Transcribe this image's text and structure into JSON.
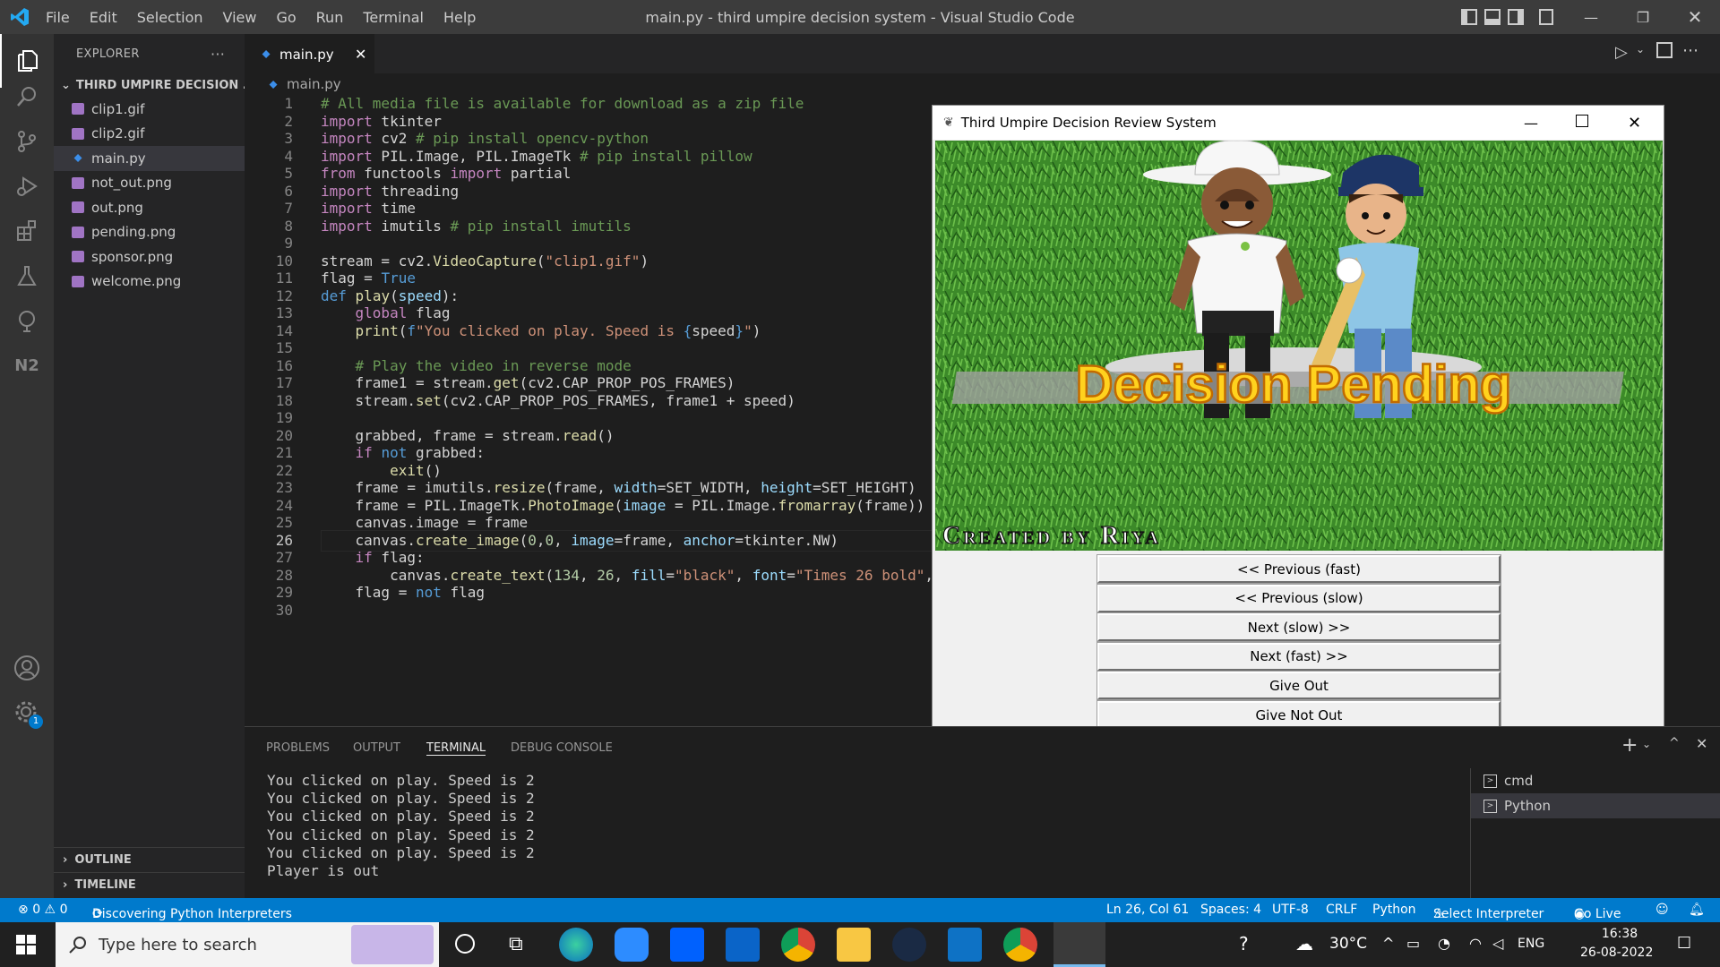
{
  "window": {
    "title": "main.py - third umpire decision system - Visual Studio Code",
    "menu": [
      "File",
      "Edit",
      "Selection",
      "View",
      "Go",
      "Run",
      "Terminal",
      "Help"
    ]
  },
  "activity_bar": {
    "icons": [
      "explorer-icon",
      "search-icon",
      "source-control-icon",
      "run-debug-icon",
      "extensions-icon",
      "testing-icon",
      "remote-explorer-icon",
      "n2-icon",
      "account-icon",
      "manage-gear-icon"
    ],
    "gear_badge": "1"
  },
  "sidebar": {
    "title": "EXPLORER",
    "more": "···",
    "project": "THIRD UMPIRE DECISION ...",
    "files": [
      {
        "name": "clip1.gif",
        "type": "image"
      },
      {
        "name": "clip2.gif",
        "type": "image"
      },
      {
        "name": "main.py",
        "type": "python"
      },
      {
        "name": "not_out.png",
        "type": "image"
      },
      {
        "name": "out.png",
        "type": "image"
      },
      {
        "name": "pending.png",
        "type": "image"
      },
      {
        "name": "sponsor.png",
        "type": "image"
      },
      {
        "name": "welcome.png",
        "type": "image"
      }
    ],
    "outline": "OUTLINE",
    "timeline": "TIMELINE"
  },
  "editor": {
    "tab": "main.py",
    "breadcrumb": "main.py",
    "current_line": 26,
    "lines": [
      {
        "n": "1"
      },
      {
        "n": "2"
      },
      {
        "n": "3"
      },
      {
        "n": "4"
      },
      {
        "n": "5"
      },
      {
        "n": "6"
      },
      {
        "n": "7"
      },
      {
        "n": "8"
      },
      {
        "n": "9"
      },
      {
        "n": "10"
      },
      {
        "n": "11"
      },
      {
        "n": "12"
      },
      {
        "n": "13"
      },
      {
        "n": "14"
      },
      {
        "n": "15"
      },
      {
        "n": "16"
      },
      {
        "n": "17"
      },
      {
        "n": "18"
      },
      {
        "n": "19"
      },
      {
        "n": "20"
      },
      {
        "n": "21"
      },
      {
        "n": "22"
      },
      {
        "n": "23"
      },
      {
        "n": "24"
      },
      {
        "n": "25"
      },
      {
        "n": "26"
      },
      {
        "n": "27"
      },
      {
        "n": "28"
      },
      {
        "n": "29"
      },
      {
        "n": "30"
      }
    ],
    "code": [
      [
        [
          "cm",
          "# All media file is available for download as a zip file"
        ]
      ],
      [
        [
          "kw",
          "import"
        ],
        [
          "",
          " tkinter"
        ]
      ],
      [
        [
          "kw",
          "import"
        ],
        [
          "",
          " cv2 "
        ],
        [
          "cm",
          "# pip install opencv-python"
        ]
      ],
      [
        [
          "kw",
          "import"
        ],
        [
          "",
          " PIL.Image, PIL.ImageTk "
        ],
        [
          "cm",
          "# pip install pillow"
        ]
      ],
      [
        [
          "kw",
          "from"
        ],
        [
          "",
          " functools "
        ],
        [
          "kw",
          "import"
        ],
        [
          "",
          " partial"
        ]
      ],
      [
        [
          "kw",
          "import"
        ],
        [
          "",
          " threading"
        ]
      ],
      [
        [
          "kw",
          "import"
        ],
        [
          "",
          " time"
        ]
      ],
      [
        [
          "kw",
          "import"
        ],
        [
          "",
          " imutils "
        ],
        [
          "cm",
          "# pip install imutils"
        ]
      ],
      [],
      [
        [
          "",
          "stream = cv2."
        ],
        [
          "fn",
          "VideoCapture"
        ],
        [
          "",
          "("
        ],
        [
          "st",
          "\"clip1.gif\""
        ],
        [
          "",
          ")"
        ]
      ],
      [
        [
          "",
          "flag = "
        ],
        [
          "bl",
          "True"
        ]
      ],
      [
        [
          "bl",
          "def"
        ],
        [
          "",
          " "
        ],
        [
          "fn",
          "play"
        ],
        [
          "",
          "("
        ],
        [
          "pm",
          "speed"
        ],
        [
          "",
          "):"
        ]
      ],
      [
        [
          "",
          "    "
        ],
        [
          "kw",
          "global"
        ],
        [
          "",
          " flag"
        ]
      ],
      [
        [
          "",
          "    "
        ],
        [
          "fn",
          "print"
        ],
        [
          "",
          "("
        ],
        [
          "bl",
          "f"
        ],
        [
          "st",
          "\"You clicked on play. Speed is "
        ],
        [
          "bl",
          "{"
        ],
        [
          "",
          "speed"
        ],
        [
          "bl",
          "}"
        ],
        [
          "st",
          "\""
        ],
        [
          "",
          ")"
        ]
      ],
      [],
      [
        [
          "",
          "    "
        ],
        [
          "cm",
          "# Play the video in reverse mode"
        ]
      ],
      [
        [
          "",
          "    frame1 = stream."
        ],
        [
          "fn",
          "get"
        ],
        [
          "",
          "(cv2.CAP_PROP_POS_FRAMES)"
        ]
      ],
      [
        [
          "",
          "    stream."
        ],
        [
          "fn",
          "set"
        ],
        [
          "",
          "(cv2.CAP_PROP_POS_FRAMES, frame1 + speed)"
        ]
      ],
      [],
      [
        [
          "",
          "    grabbed, frame = stream."
        ],
        [
          "fn",
          "read"
        ],
        [
          "",
          "()"
        ]
      ],
      [
        [
          "",
          "    "
        ],
        [
          "kw",
          "if"
        ],
        [
          "",
          " "
        ],
        [
          "bl",
          "not"
        ],
        [
          "",
          " grabbed:"
        ]
      ],
      [
        [
          "",
          "        "
        ],
        [
          "fn",
          "exit"
        ],
        [
          "",
          "()"
        ]
      ],
      [
        [
          "",
          "    frame = imutils."
        ],
        [
          "fn",
          "resize"
        ],
        [
          "",
          "(frame, "
        ],
        [
          "pm",
          "width"
        ],
        [
          "",
          "=SET_WIDTH, "
        ],
        [
          "pm",
          "height"
        ],
        [
          "",
          "=SET_HEIGHT)"
        ]
      ],
      [
        [
          "",
          "    frame = PIL.ImageTk."
        ],
        [
          "fn",
          "PhotoImage"
        ],
        [
          "",
          "("
        ],
        [
          "pm",
          "image"
        ],
        [
          "",
          " = PIL.Image."
        ],
        [
          "fn",
          "fromarray"
        ],
        [
          "",
          "(frame))"
        ]
      ],
      [
        [
          "",
          "    canvas.image = frame"
        ]
      ],
      [
        [
          "",
          "    canvas."
        ],
        [
          "fn",
          "create_image"
        ],
        [
          "",
          "("
        ],
        [
          "nm",
          "0"
        ],
        [
          "",
          ","
        ],
        [
          "nm",
          "0"
        ],
        [
          "",
          ", "
        ],
        [
          "pm",
          "image"
        ],
        [
          "",
          "=frame, "
        ],
        [
          "pm",
          "anchor"
        ],
        [
          "",
          "=tkinter.NW)"
        ]
      ],
      [
        [
          "",
          "    "
        ],
        [
          "kw",
          "if"
        ],
        [
          "",
          " flag:"
        ]
      ],
      [
        [
          "",
          "        canvas."
        ],
        [
          "fn",
          "create_text"
        ],
        [
          "",
          "("
        ],
        [
          "nm",
          "134"
        ],
        [
          "",
          ", "
        ],
        [
          "nm",
          "26"
        ],
        [
          "",
          ", "
        ],
        [
          "pm",
          "fill"
        ],
        [
          "",
          "="
        ],
        [
          "st",
          "\"black\""
        ],
        [
          "",
          ", "
        ],
        [
          "pm",
          "font"
        ],
        [
          "",
          "="
        ],
        [
          "st",
          "\"Times 26 bold\""
        ],
        [
          "",
          ","
        ]
      ],
      [
        [
          "",
          "    flag = "
        ],
        [
          "bl",
          "not"
        ],
        [
          "",
          " flag"
        ]
      ],
      []
    ]
  },
  "panel": {
    "tabs": [
      "PROBLEMS",
      "OUTPUT",
      "TERMINAL",
      "DEBUG CONSOLE"
    ],
    "active_tab": "TERMINAL",
    "terminal_lines": [
      "You clicked on play. Speed is 2",
      "You clicked on play. Speed is 2",
      "You clicked on play. Speed is 2",
      "You clicked on play. Speed is 2",
      "You clicked on play. Speed is 2",
      "Player is out"
    ],
    "terminals": [
      "cmd",
      "Python"
    ],
    "selected_terminal": "Python"
  },
  "tk_window": {
    "title": "Third Umpire Decision Review System",
    "banner_text": "Decision Pending",
    "credit_text": "Created by Riya",
    "buttons": [
      "<< Previous (fast)",
      "<< Previous (slow)",
      "Next (slow) >>",
      "Next (fast) >>",
      "Give Out",
      "Give Not Out"
    ]
  },
  "statusbar": {
    "errors": "0",
    "warnings": "0",
    "discovering": "Discovering Python Interpreters",
    "position": "Ln 26, Col 61",
    "spaces": "Spaces: 4",
    "encoding": "UTF-8",
    "eol": "CRLF",
    "language": "Python",
    "interpreter": "Select Interpreter",
    "golive": "Go Live"
  },
  "taskbar": {
    "search_placeholder": "Type here to search",
    "weather": "30°C",
    "language": "ENG",
    "time": "16:38",
    "date": "26-08-2022"
  },
  "colors": {
    "statusbar": "#007acc",
    "activitybar": "#333333",
    "sidebar": "#252526",
    "editor": "#1e1e1e",
    "banner_yellow": "#ffd21e",
    "grass": "#3e8a2a"
  }
}
